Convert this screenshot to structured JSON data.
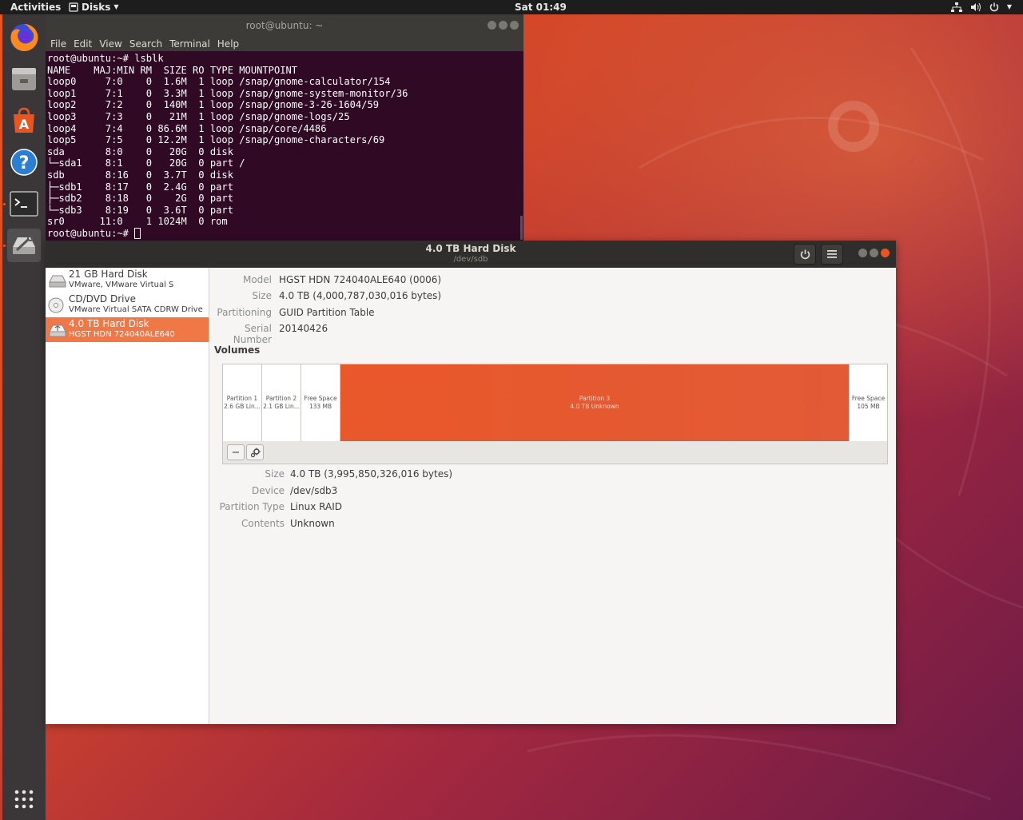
{
  "colors": {
    "accent": "#e95420",
    "selected_row": "#f07746",
    "terminal_bg": "#300a24"
  },
  "topbar": {
    "activities": "Activities",
    "app_name": "Disks",
    "clock": "Sat 01:49"
  },
  "dock": {
    "items": [
      "firefox-icon",
      "files-icon",
      "software-icon",
      "help-icon",
      "terminal-icon",
      "disks-icon"
    ],
    "apps_grid": "show-applications-icon"
  },
  "terminal": {
    "title": "root@ubuntu: ~",
    "menu": [
      "File",
      "Edit",
      "View",
      "Search",
      "Terminal",
      "Help"
    ],
    "lines": [
      "root@ubuntu:~# lsblk",
      "NAME    MAJ:MIN RM  SIZE RO TYPE MOUNTPOINT",
      "loop0     7:0    0  1.6M  1 loop /snap/gnome-calculator/154",
      "loop1     7:1    0  3.3M  1 loop /snap/gnome-system-monitor/36",
      "loop2     7:2    0  140M  1 loop /snap/gnome-3-26-1604/59",
      "loop3     7:3    0   21M  1 loop /snap/gnome-logs/25",
      "loop4     7:4    0 86.6M  1 loop /snap/core/4486",
      "loop5     7:5    0 12.2M  1 loop /snap/gnome-characters/69",
      "sda       8:0    0   20G  0 disk",
      "└─sda1    8:1    0   20G  0 part /",
      "sdb       8:16   0  3.7T  0 disk",
      "├─sdb1    8:17   0  2.4G  0 part",
      "├─sdb2    8:18   0    2G  0 part",
      "└─sdb3    8:19   0  3.6T  0 part",
      "sr0      11:0    1 1024M  0 rom"
    ],
    "prompt": "root@ubuntu:~# "
  },
  "disks": {
    "title": "4.0 TB Hard Disk",
    "subtitle": "/dev/sdb",
    "drives": [
      {
        "name": "21 GB Hard Disk",
        "sub": "VMware, VMware Virtual S"
      },
      {
        "name": "CD/DVD Drive",
        "sub": "VMware Virtual SATA CDRW Drive"
      },
      {
        "name": "4.0 TB Hard Disk",
        "sub": "HGST HDN 724040ALE640"
      }
    ],
    "props": {
      "model_label": "Model",
      "model": "HGST HDN 724040ALE640 (0006)",
      "size_label": "Size",
      "size": "4.0 TB (4,000,787,030,016 bytes)",
      "partitioning_label": "Partitioning",
      "partitioning": "GUID Partition Table",
      "serial_label": "Serial Number",
      "serial": "20140426"
    },
    "volumes_heading": "Volumes",
    "segments": [
      {
        "name": "Partition 1",
        "desc": "2.6 GB Lin..."
      },
      {
        "name": "Partition 2",
        "desc": "2.1 GB Lin..."
      },
      {
        "name": "Free Space",
        "desc": "133 MB"
      },
      {
        "name": "Partition 3",
        "desc": "4.0 TB Unknown"
      },
      {
        "name": "Free Space",
        "desc": "105 MB"
      }
    ],
    "partition": {
      "size_label": "Size",
      "size": "4.0 TB (3,995,850,326,016 bytes)",
      "device_label": "Device",
      "device": "/dev/sdb3",
      "type_label": "Partition Type",
      "type": "Linux RAID",
      "contents_label": "Contents",
      "contents": "Unknown"
    },
    "tools": {
      "remove": "−"
    }
  }
}
